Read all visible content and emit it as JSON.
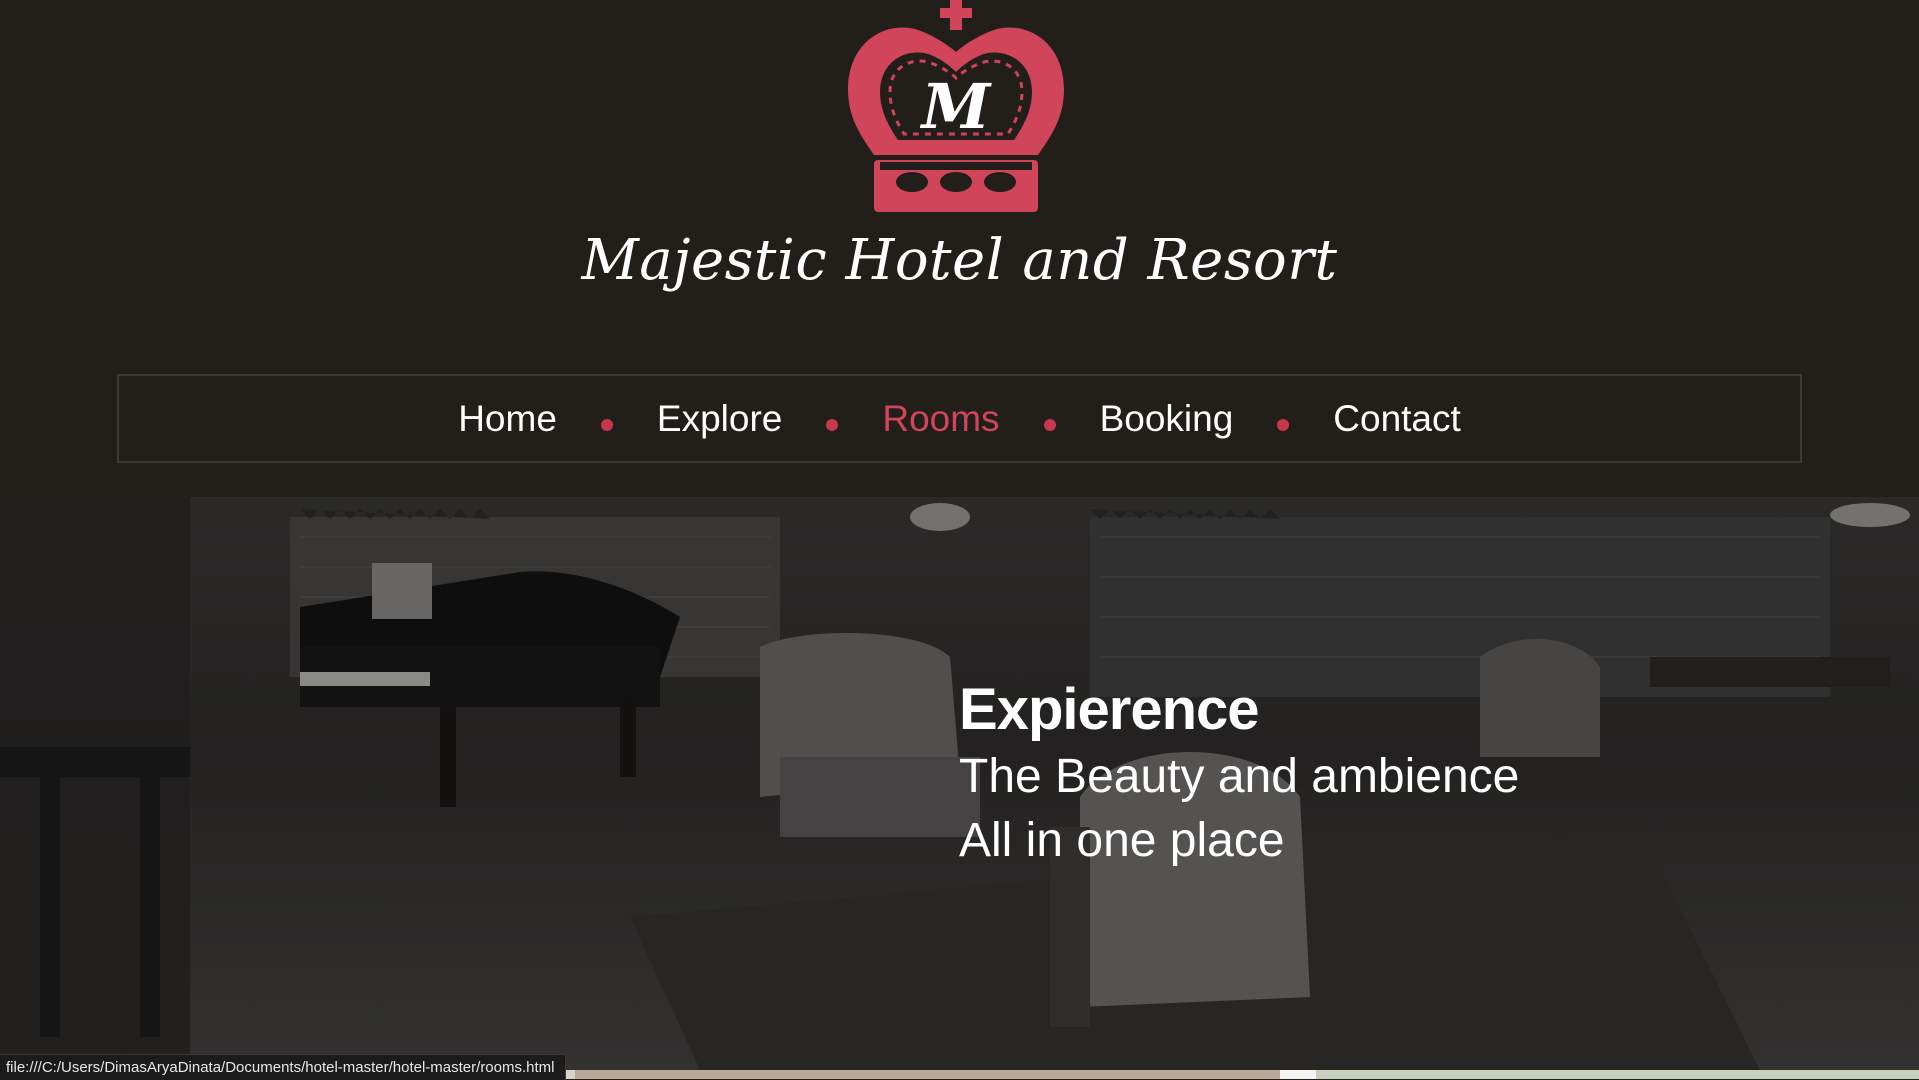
{
  "brand": {
    "logo_letter": "M",
    "name": "Majestic Hotel and Resort",
    "accent_color": "#d0455a",
    "logo": "crown-logo"
  },
  "nav": {
    "items": [
      {
        "label": "Home",
        "active": false
      },
      {
        "label": "Explore",
        "active": false
      },
      {
        "label": "Rooms",
        "active": true
      },
      {
        "label": "Booking",
        "active": false
      },
      {
        "label": "Contact",
        "active": false
      }
    ]
  },
  "hero": {
    "title": "Expierence",
    "line1": "The Beauty and ambience",
    "line2": "All in one place"
  },
  "status_bar": {
    "url": "file:///C:/Users/DimasAryaDinata/Documents/hotel-master/hotel-master/rooms.html"
  }
}
